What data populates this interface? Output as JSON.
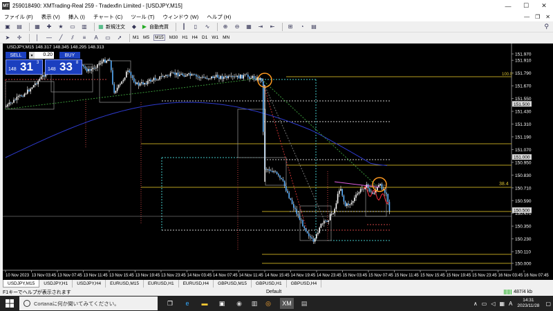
{
  "window": {
    "title": "259018490: XMTrading-Real 259 - Tradexfin Limited - [USDJPY,M15]",
    "app_icon": "MT",
    "minimize": "—",
    "maximize": "☐",
    "close": "✕"
  },
  "menu": [
    "ファイル (F)",
    "表示 (V)",
    "挿入 (I)",
    "チャート (C)",
    "ツール (T)",
    "ウィンドウ (W)",
    "ヘルプ (H)"
  ],
  "mdi_controls": [
    "—",
    "❐",
    "✕"
  ],
  "toolbar": {
    "new_order": "新規注文",
    "auto_trade": "自動売買",
    "timeframes": [
      "M1",
      "M5",
      "M15",
      "M30",
      "H1",
      "H4",
      "D1",
      "W1",
      "MN"
    ]
  },
  "chart": {
    "symbol_label": "USDJPY,M15  148.317 148.345 148.295 148.313",
    "sell_label": "SELL",
    "buy_label": "BUY",
    "lot": "0.20",
    "sell_pre": "148",
    "sell_big": "31",
    "sell_sup": "3",
    "buy_pre": "148",
    "buy_big": "33",
    "buy_sup": "8",
    "fib_100": "100.0",
    "fib_38": "38.4",
    "price_labels": [
      "151.970",
      "151.910",
      "151.790",
      "151.670",
      "151.550",
      "151.430",
      "151.310",
      "151.190",
      "151.070",
      "150.950",
      "150.830",
      "150.710",
      "150.590",
      "150.470",
      "150.350",
      "150.230",
      "150.110",
      "150.000"
    ],
    "highlight_prices": [
      {
        "text": "151.500",
        "value": 151.5
      },
      {
        "text": "151.000",
        "value": 151.0
      },
      {
        "text": "150.500",
        "value": 150.5
      }
    ],
    "time_labels": [
      "10 Nov 2023",
      "13 Nov 03:45",
      "13 Nov 07:45",
      "13 Nov 11:45",
      "13 Nov 15:45",
      "13 Nov 19:45",
      "13 Nov 23:45",
      "14 Nov 03:45",
      "14 Nov 07:45",
      "14 Nov 11:45",
      "14 Nov 15:45",
      "14 Nov 19:45",
      "14 Nov 23:45",
      "15 Nov 03:45",
      "15 Nov 07:45",
      "15 Nov 11:45",
      "15 Nov 15:45",
      "15 Nov 19:45",
      "15 Nov 23:45",
      "16 Nov 03:45",
      "16 Nov 07:45"
    ]
  },
  "tabs": [
    "USDJPY,M15",
    "USDJPY,H1",
    "USDJPY,H4",
    "EURUSD,M15",
    "EURUSD,H1",
    "EURUSD,H4",
    "GBPUSD,M15",
    "GBPUSD,H1",
    "GBPUSD,H4"
  ],
  "status": {
    "help": "F1キーでヘルプが表示されます",
    "profile": "Default",
    "traffic": "487/4 kb"
  },
  "taskbar": {
    "cortana": "Cortanaに何か聞いてみてください。",
    "ime": "A",
    "time": "14:31",
    "date": "2023/11/28"
  }
}
